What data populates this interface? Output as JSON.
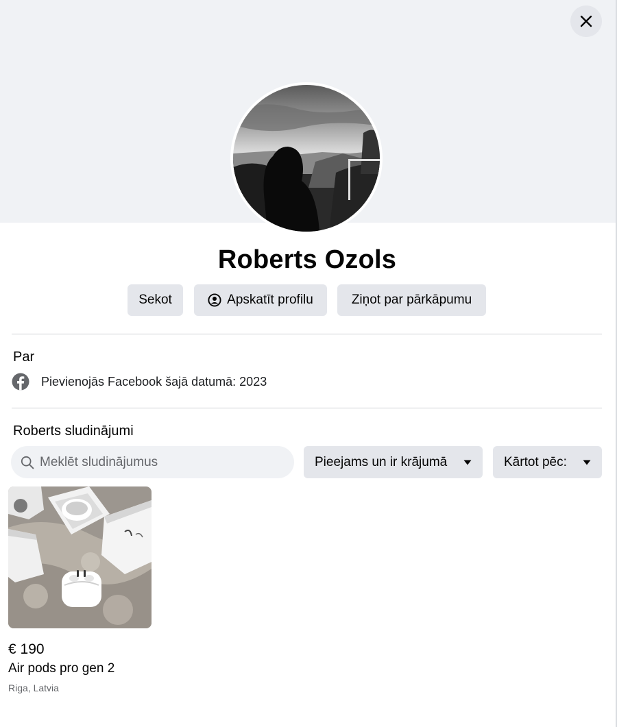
{
  "profile": {
    "name": "Roberts Ozols"
  },
  "actions": {
    "follow_label": "Sekot",
    "view_profile_label": "Apskatīt profilu",
    "report_label": "Ziņot par pārkāpumu"
  },
  "about": {
    "title": "Par",
    "joined_text": "Pievienojās Facebook šajā datumā: 2023"
  },
  "listings": {
    "title": "Roberts sludinājumi",
    "search_placeholder": "Meklēt sludinājumus",
    "availability_filter": "Pieejams un ir krājumā",
    "sort_label": "Kārtot pēc:",
    "items": [
      {
        "price": "€ 190",
        "title": "Air pods pro gen 2",
        "location": "Riga, Latvia"
      }
    ]
  },
  "icons": {
    "close": "close-icon",
    "profile": "user-circle-icon",
    "facebook": "facebook-icon",
    "search": "search-icon",
    "caret": "caret-down-icon"
  },
  "colors": {
    "cover_background": "#f0f2f5",
    "button_background": "#e4e6eb",
    "secondary_text": "#65676b"
  }
}
